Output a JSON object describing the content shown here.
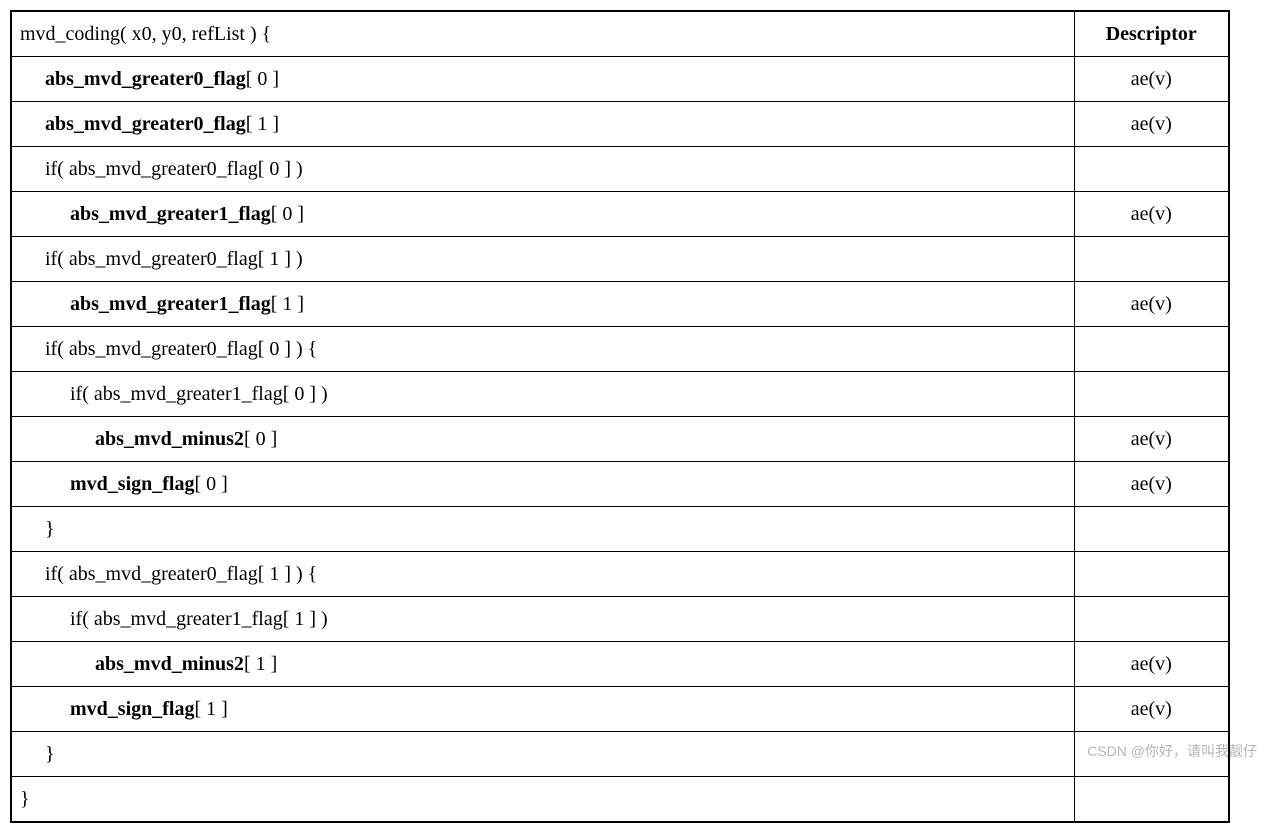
{
  "table": {
    "header": {
      "code": "mvd_coding( x0, y0, refList ) {",
      "descriptor_label": "Descriptor"
    },
    "rows": [
      {
        "indent": 1,
        "bold_text": "abs_mvd_greater0_flag",
        "suffix": "[ 0 ]",
        "descriptor": "ae(v)"
      },
      {
        "indent": 1,
        "bold_text": "abs_mvd_greater0_flag",
        "suffix": "[ 1 ]",
        "descriptor": "ae(v)"
      },
      {
        "indent": 1,
        "plain_text": "if( abs_mvd_greater0_flag[ 0 ] )",
        "descriptor": ""
      },
      {
        "indent": 2,
        "bold_text": "abs_mvd_greater1_flag",
        "suffix": "[ 0 ]",
        "descriptor": "ae(v)"
      },
      {
        "indent": 1,
        "plain_text": "if( abs_mvd_greater0_flag[ 1 ] )",
        "descriptor": ""
      },
      {
        "indent": 2,
        "bold_text": "abs_mvd_greater1_flag",
        "suffix": "[ 1 ]",
        "descriptor": "ae(v)"
      },
      {
        "indent": 1,
        "plain_text": "if( abs_mvd_greater0_flag[ 0 ] ) {",
        "descriptor": ""
      },
      {
        "indent": 2,
        "plain_text": "if( abs_mvd_greater1_flag[ 0 ] )",
        "descriptor": ""
      },
      {
        "indent": 3,
        "bold_text": "abs_mvd_minus2",
        "suffix": "[ 0 ]",
        "descriptor": "ae(v)"
      },
      {
        "indent": 2,
        "bold_text": "mvd_sign_flag",
        "suffix": "[ 0 ]",
        "descriptor": "ae(v)"
      },
      {
        "indent": 1,
        "plain_text": "}",
        "descriptor": ""
      },
      {
        "indent": 1,
        "plain_text": "if( abs_mvd_greater0_flag[ 1 ] ) {",
        "descriptor": ""
      },
      {
        "indent": 2,
        "plain_text": "if( abs_mvd_greater1_flag[ 1 ] )",
        "descriptor": ""
      },
      {
        "indent": 3,
        "bold_text": "abs_mvd_minus2",
        "suffix": "[ 1 ]",
        "descriptor": "ae(v)"
      },
      {
        "indent": 2,
        "bold_text": "mvd_sign_flag",
        "suffix": "[ 1 ]",
        "descriptor": "ae(v)"
      },
      {
        "indent": 1,
        "plain_text": "}",
        "descriptor": ""
      },
      {
        "indent": 0,
        "plain_text": "}",
        "descriptor": ""
      }
    ]
  },
  "watermark": "CSDN @你好，请叫我靓仔"
}
